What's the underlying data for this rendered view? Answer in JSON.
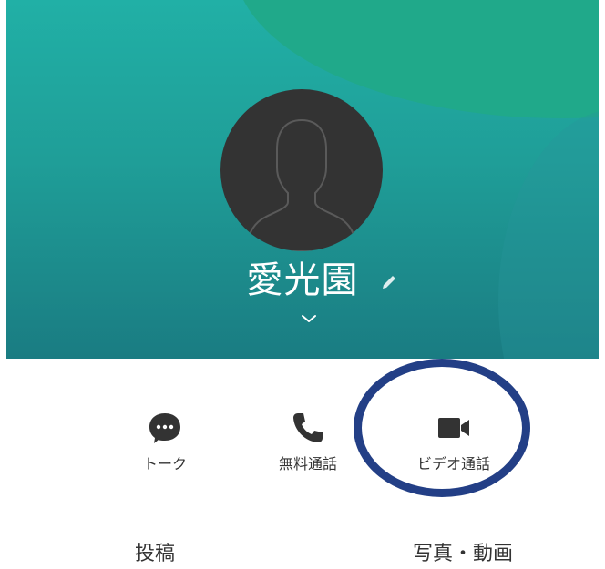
{
  "profile": {
    "name": "愛光園"
  },
  "actions": [
    {
      "label": "トーク",
      "icon": "chat-bubble-icon"
    },
    {
      "label": "無料通話",
      "icon": "phone-icon"
    },
    {
      "label": "ビデオ通話",
      "icon": "video-camera-icon"
    }
  ],
  "tabs": [
    {
      "label": "投稿"
    },
    {
      "label": "写真・動画"
    }
  ],
  "colors": {
    "header_teal": "#1f9e98",
    "header_green": "#20a98a",
    "avatar_bg": "#333333",
    "icon_dark": "#333333",
    "annotation_ring": "#233f86"
  }
}
